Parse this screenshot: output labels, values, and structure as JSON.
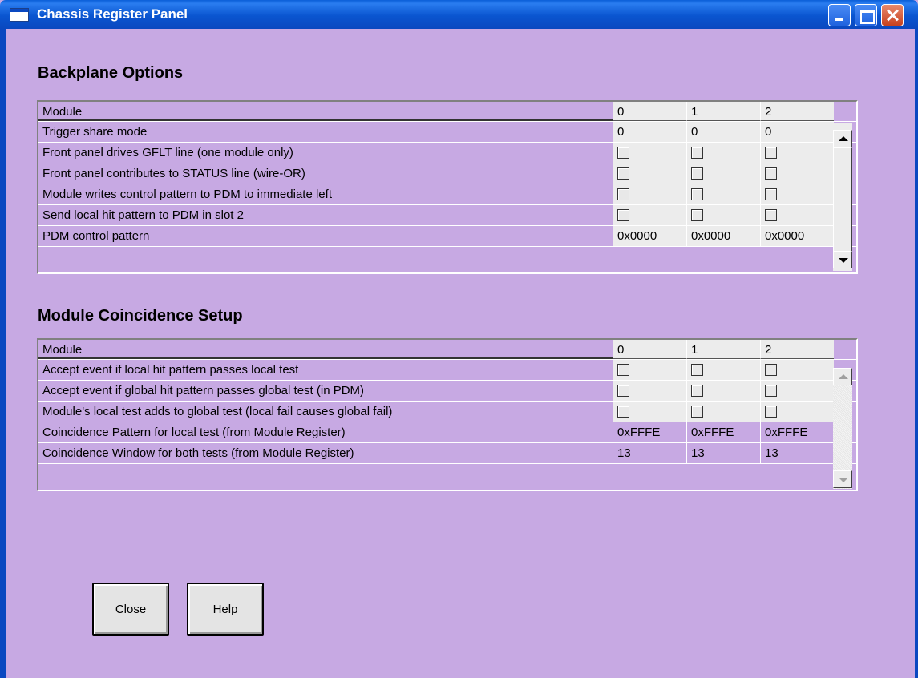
{
  "window": {
    "title": "Chassis Register Panel"
  },
  "backplane": {
    "title": "Backplane Options",
    "header": {
      "label": "Module",
      "cols": [
        "0",
        "1",
        "2"
      ]
    },
    "rows": [
      {
        "label": "Trigger share mode",
        "values": [
          "0",
          "0",
          "0"
        ]
      },
      {
        "label": "Front panel drives GFLT line (one module only)",
        "checkboxes": [
          false,
          false,
          false
        ]
      },
      {
        "label": "Front panel contributes to STATUS line (wire-OR)",
        "checkboxes": [
          false,
          false,
          false
        ]
      },
      {
        "label": "Module writes control pattern to PDM to immediate left",
        "checkboxes": [
          false,
          false,
          false
        ]
      },
      {
        "label": "Send local hit pattern to PDM in slot 2",
        "checkboxes": [
          false,
          false,
          false
        ]
      },
      {
        "label": "PDM control pattern",
        "values": [
          "0x0000",
          "0x0000",
          "0x0000"
        ]
      }
    ]
  },
  "coincidence": {
    "title": "Module Coincidence Setup",
    "header": {
      "label": "Module",
      "cols": [
        "0",
        "1",
        "2"
      ]
    },
    "rows": [
      {
        "label": "Accept event if local hit pattern passes local test",
        "checkboxes": [
          false,
          false,
          false
        ]
      },
      {
        "label": "Accept event if global hit pattern passes global test (in PDM)",
        "checkboxes": [
          false,
          false,
          false
        ]
      },
      {
        "label": "Module's local test adds to global test (local fail causes global fail)",
        "checkboxes": [
          false,
          false,
          false
        ]
      },
      {
        "label": "Coincidence Pattern for local test (from Module Register)",
        "values": [
          "0xFFFE",
          "0xFFFE",
          "0xFFFE"
        ]
      },
      {
        "label": "Coincidence Window for both tests (from Module Register)",
        "values": [
          "13",
          "13",
          "13"
        ]
      }
    ]
  },
  "buttons": {
    "close": "Close",
    "help": "Help"
  }
}
